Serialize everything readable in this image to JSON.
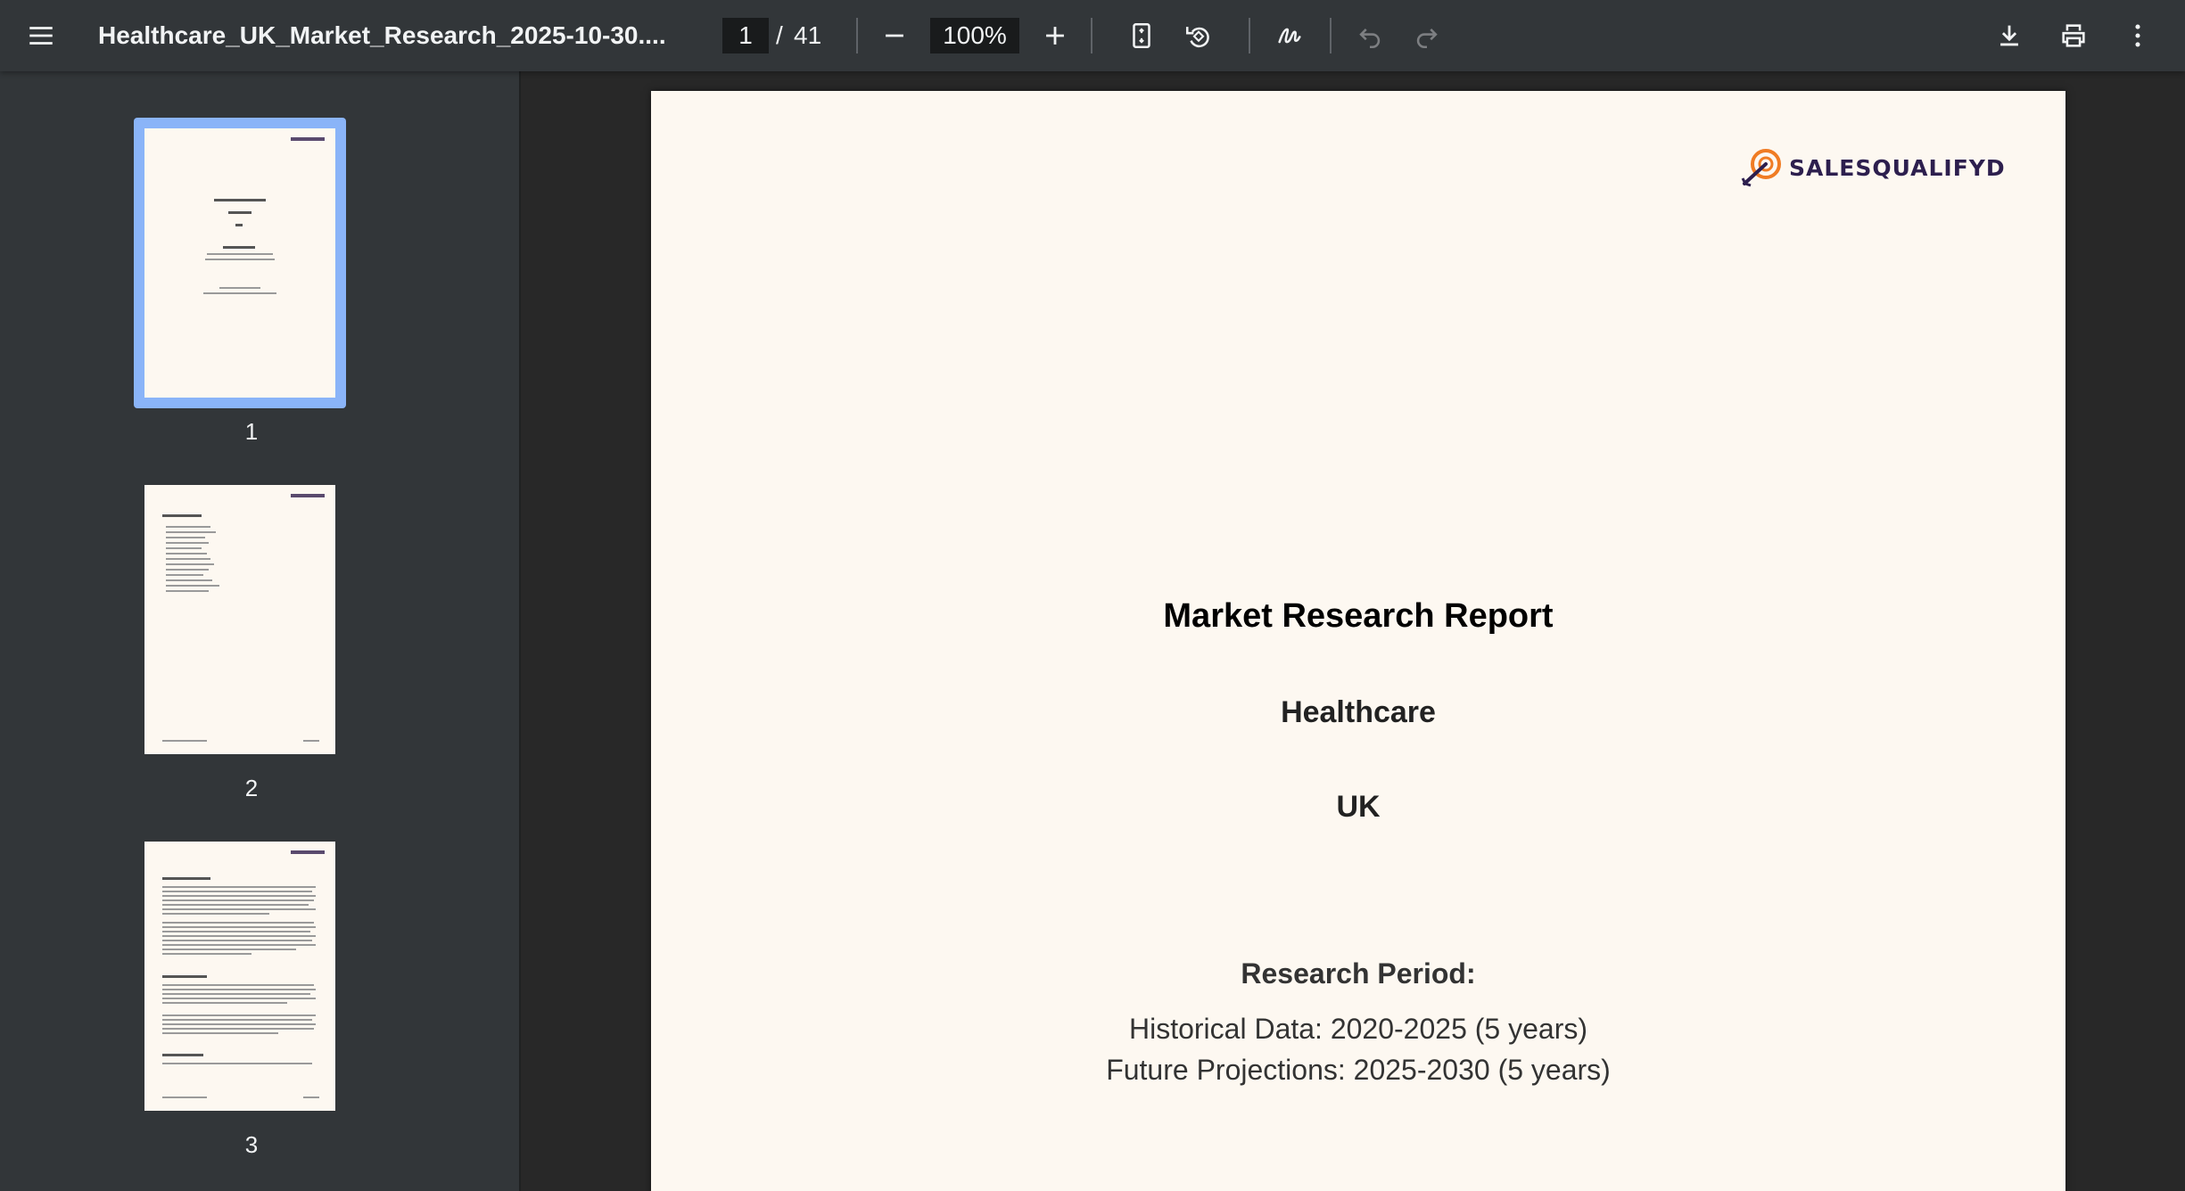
{
  "toolbar": {
    "title": "Healthcare_UK_Market_Research_2025-10-30....",
    "current_page": "1",
    "page_separator": "/",
    "total_pages": "41",
    "zoom": "100%"
  },
  "icons": {
    "menu": "menu-icon",
    "zoom_out": "minus-icon",
    "zoom_in": "plus-icon",
    "fit_page": "fit-page-icon",
    "rotate": "rotate-icon",
    "annotate": "annotate-icon",
    "undo": "undo-icon",
    "redo": "redo-icon",
    "download": "download-icon",
    "print": "print-icon",
    "more": "more-vert-icon"
  },
  "sidebar": {
    "thumbnails": [
      {
        "number": "1",
        "selected": true
      },
      {
        "number": "2",
        "selected": false
      },
      {
        "number": "3",
        "selected": false
      }
    ]
  },
  "document": {
    "logo_text": "SALESQUALIFYD",
    "report_title": "Market Research Report",
    "industry": "Healthcare",
    "region": "UK",
    "period_heading": "Research Period:",
    "historical": "Historical Data: 2020-2025 (5 years)",
    "future": "Future Projections: 2025-2030 (5 years)"
  },
  "colors": {
    "toolbar_bg": "#323639",
    "viewer_bg": "#282828",
    "page_bg": "#fdf8f1",
    "selection": "#8ab4f8",
    "logo_orange": "#f07c24",
    "logo_navy": "#2d1f4e"
  }
}
